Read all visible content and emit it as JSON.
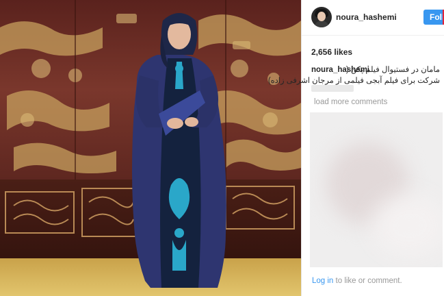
{
  "post": {
    "username": "noura_hashemi",
    "follow_label": "Follow",
    "likes": "2,656 likes",
    "caption_user": "noura_hashemi",
    "caption_line1": "مامان در فستیوال فیلم پکن (",
    "caption_line2": "شرکت برای فیلم آبجی فیلمی از مرجان اشرفی زاده)",
    "load_more": "load more comments",
    "login_link": "Log in",
    "login_rest": " to like or comment."
  },
  "colors": {
    "accent": "#3897f0",
    "text": "#262626",
    "muted": "#999999",
    "photo_wall": "#6a2f27",
    "dress": "#2e3570",
    "embroidery": "#2aa7c9"
  }
}
